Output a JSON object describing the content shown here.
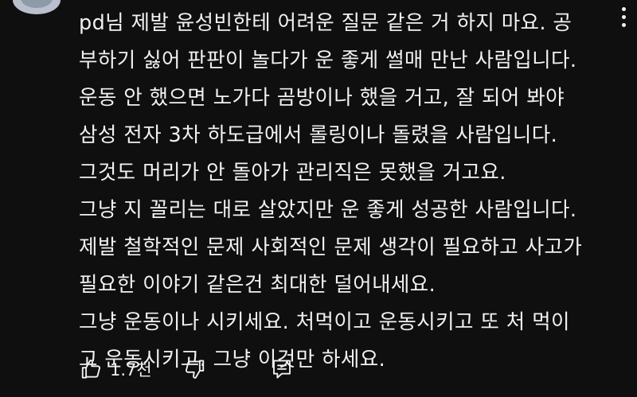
{
  "comment": {
    "lines": [
      "pd님 제발 윤성빈한테 어려운 질문 같은 거 하지 마요. 공",
      "부하기 싫어 판판이 놀다가 운 좋게 썰매 만난 사람입니다.",
      "운동 안 했으면 노가다 곰방이나 했을 거고, 잘 되어 봐야",
      "삼성 전자 3차 하도급에서 롤링이나 돌렸을 사람입니다.",
      "그것도 머리가 안 돌아가 관리직은 못했을 거고요.",
      "그냥 지 꼴리는 대로 살았지만 운 좋게 성공한 사람입니다.",
      "제발 철학적인 문제 사회적인 문제 생각이 필요하고 사고가",
      "필요한 이야기 같은건 최대한 덜어내세요.",
      "그냥 운동이나 시키세요. 처먹이고 운동시키고 또 처 먹이",
      "고 운동시키고. 그냥 이것만 하세요."
    ]
  },
  "actions": {
    "like_count": "1.7천",
    "like_icon": "thumbs-up-icon",
    "dislike_icon": "thumbs-down-icon",
    "reply_icon": "reply-comment-icon",
    "menu_icon": "more-vertical-icon"
  },
  "colors": {
    "background": "#0f0f0f",
    "text": "#f1f1f1"
  }
}
